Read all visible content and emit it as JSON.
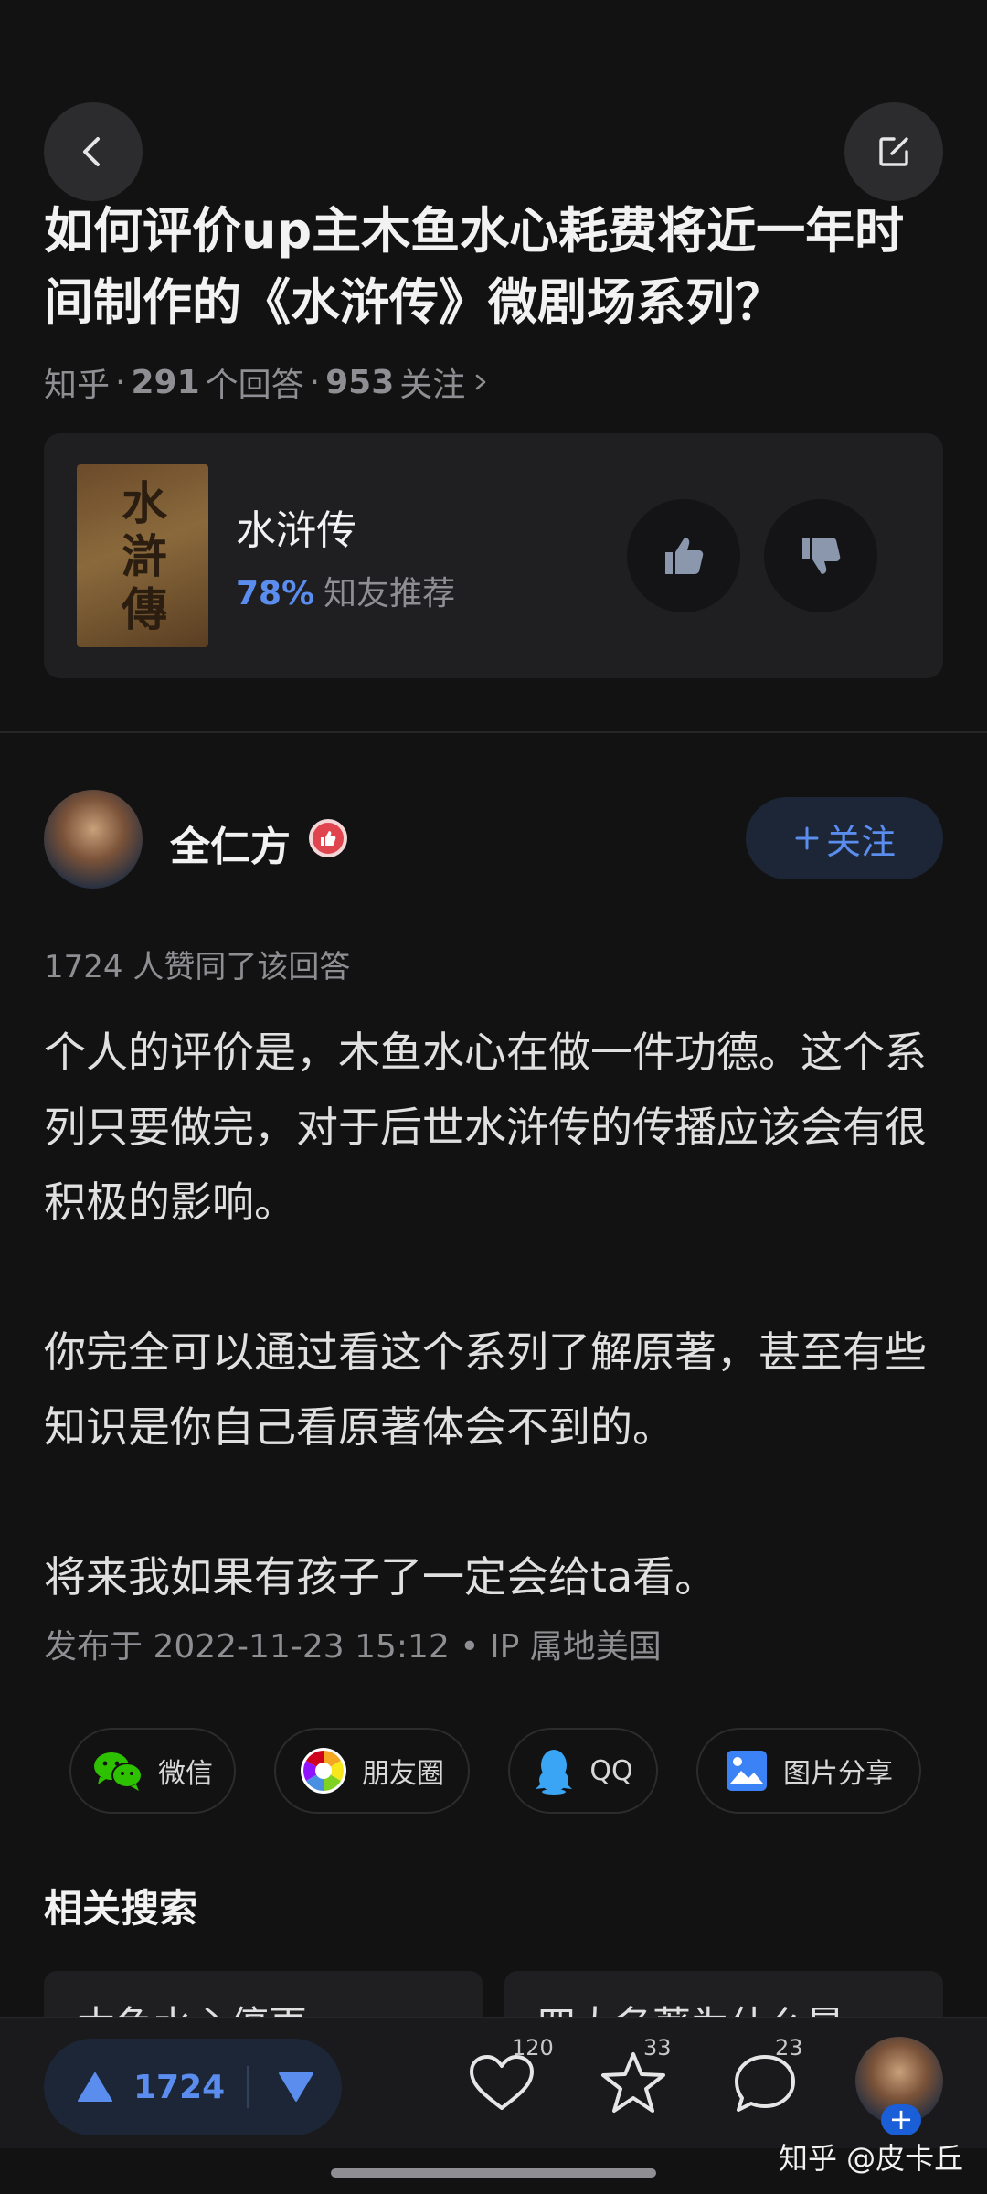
{
  "question": {
    "title": "如何评价up主木鱼水心耗费将近一年时间制作的《水浒传》微剧场系列？",
    "source": "知乎",
    "answers_count": "291",
    "answers_label": "个回答",
    "followers_count": "953",
    "followers_label": "关注"
  },
  "rating_card": {
    "cover_text": "水滸傳",
    "book_title": "水浒传",
    "percent": "78%",
    "recommend_label": "知友推荐"
  },
  "author": {
    "name": "全仁方",
    "follow_label": "关注"
  },
  "answer": {
    "likes_line": "1724 人赞同了该回答",
    "paragraphs": [
      "个人的评价是，木鱼水心在做一件功德。这个系列只要做完，对于后世水浒传的传播应该会有很积极的影响。",
      "你完全可以通过看这个系列了解原著，甚至有些知识是你自己看原著体会不到的。",
      "将来我如果有孩子了一定会给ta看。"
    ],
    "publish_line": "发布于 2022-11-23 15:12 • IP 属地美国"
  },
  "share": {
    "wechat": "微信",
    "moments": "朋友圈",
    "qq": "QQ",
    "image": "图片分享"
  },
  "related": {
    "title": "相关搜索",
    "items": [
      "木鱼水心停更",
      "四大名著为什么是"
    ]
  },
  "bottom_bar": {
    "vote_count": "1724",
    "like_count": "120",
    "favorite_count": "33",
    "comment_count": "23"
  },
  "watermark": "知乎 @皮卡丘",
  "colors": {
    "background": "#121212",
    "accent": "#5b8def",
    "card": "#1f1f21",
    "badge": "#e0454f"
  }
}
